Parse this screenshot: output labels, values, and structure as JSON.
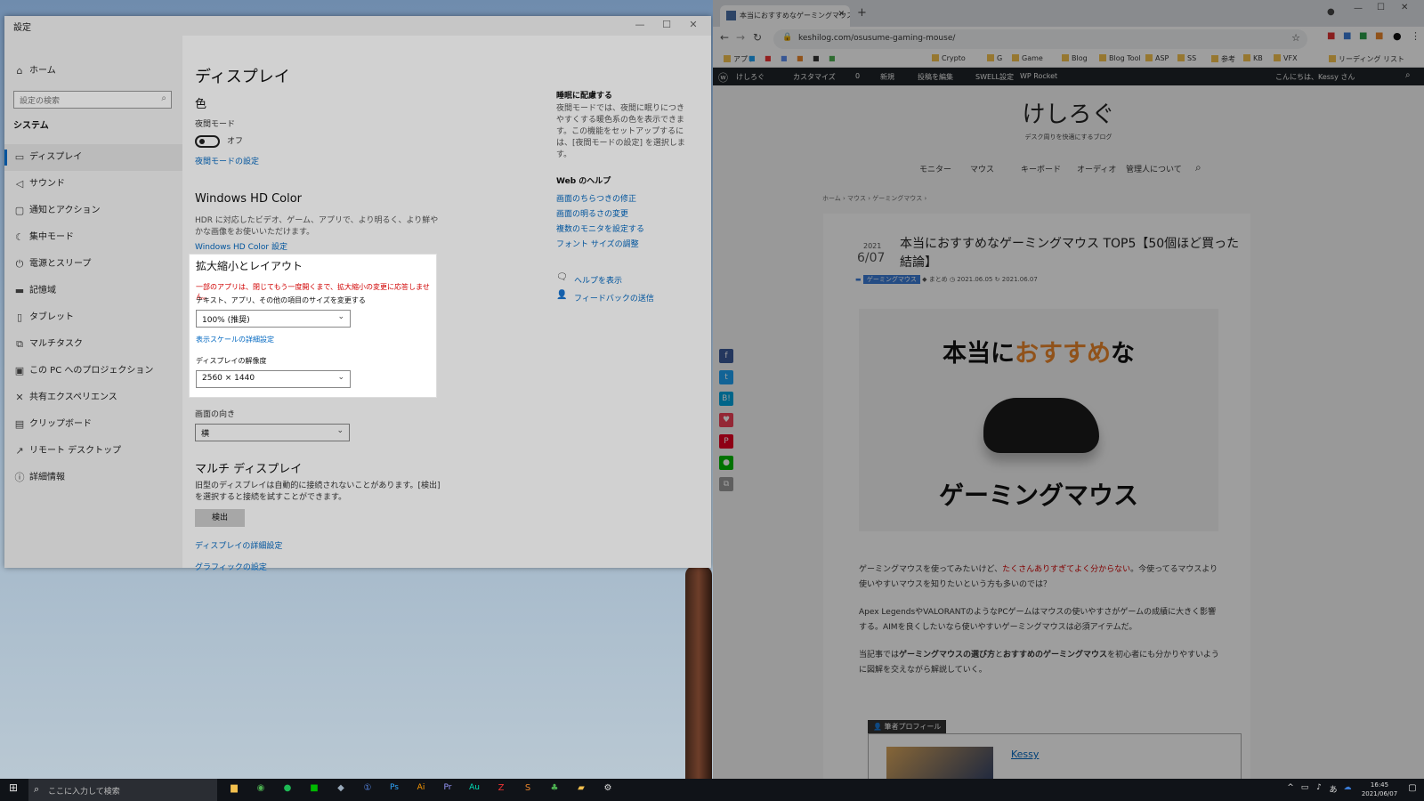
{
  "settings": {
    "window_title": "設定",
    "search_placeholder": "設定の検索",
    "home_label": "ホーム",
    "section_label": "システム",
    "sidebar_items": [
      {
        "label": "ディスプレイ",
        "icon": "monitor-icon"
      },
      {
        "label": "サウンド",
        "icon": "speaker-icon"
      },
      {
        "label": "通知とアクション",
        "icon": "notification-icon"
      },
      {
        "label": "集中モード",
        "icon": "moon-icon"
      },
      {
        "label": "電源とスリープ",
        "icon": "power-icon"
      },
      {
        "label": "記憶域",
        "icon": "storage-icon"
      },
      {
        "label": "タブレット",
        "icon": "tablet-icon"
      },
      {
        "label": "マルチタスク",
        "icon": "multitask-icon"
      },
      {
        "label": "この PC へのプロジェクション",
        "icon": "projection-icon"
      },
      {
        "label": "共有エクスペリエンス",
        "icon": "share-icon"
      },
      {
        "label": "クリップボード",
        "icon": "clipboard-icon"
      },
      {
        "label": "リモート デスクトップ",
        "icon": "remote-icon"
      },
      {
        "label": "詳細情報",
        "icon": "info-icon"
      }
    ],
    "main": {
      "title": "ディスプレイ",
      "color_heading": "色",
      "night_mode_label": "夜間モード",
      "night_mode_state": "オフ",
      "night_mode_link": "夜間モードの設定",
      "hd_heading": "Windows HD Color",
      "hd_desc": "HDR に対応したビデオ、ゲーム、アプリで、より明るく、より鮮やかな画像をお使いいただけます。",
      "hd_link": "Windows HD Color 設定",
      "scale_heading": "拡大縮小とレイアウト",
      "scale_warning": "一部のアプリは、閉じてもう一度開くまで、拡大縮小の変更に応答しません。",
      "scale_label": "テキスト、アプリ、その他の項目のサイズを変更する",
      "scale_value": "100% (推奨)",
      "scale_link": "表示スケールの詳細設定",
      "resolution_label": "ディスプレイの解像度",
      "resolution_value": "2560 × 1440",
      "orientation_label": "画面の向き",
      "orientation_value": "横",
      "multi_heading": "マルチ ディスプレイ",
      "multi_desc": "旧型のディスプレイは自動的に接続されないことがあります。[検出] を選択すると接続を試すことができます。",
      "detect_button": "検出",
      "advanced_link": "ディスプレイの詳細設定",
      "graphics_link": "グラフィックの設定"
    },
    "right": {
      "sleep_heading": "睡眠に配慮する",
      "sleep_desc": "夜間モードでは、夜間に眠りにつきやすくする暖色系の色を表示できます。この機能をセットアップするには、[夜間モードの設定] を選択します。",
      "web_help_heading": "Web のヘルプ",
      "help_links": [
        "画面のちらつきの修正",
        "画面の明るさの変更",
        "複数のモニタを設定する",
        "フォント サイズの調整"
      ],
      "show_help": "ヘルプを表示",
      "feedback": "フィードバックの送信"
    }
  },
  "browser": {
    "tab_title": "本当におすすめなゲーミングマウス TO",
    "url": "keshilog.com/osusume-gaming-mouse/",
    "bookmarks": [
      "アプリ",
      "Crypto",
      "G",
      "Game",
      "Blog",
      "Blog Tool",
      "ASP",
      "SS",
      "参考",
      "KB",
      "VFX",
      "リーディング リスト"
    ],
    "wp_items": [
      "けしろぐ",
      "カスタマイズ",
      "0",
      "新規",
      "投稿を編集",
      "SWELL設定",
      "WP Rocket"
    ],
    "wp_greeting": "こんにちは、Kessy さん",
    "site_title": "けしろぐ",
    "tagline": "デスク周りを快適にするブログ",
    "nav": [
      "モニター",
      "マウス",
      "キーボード",
      "オーディオ",
      "管理人について"
    ],
    "breadcrumb": [
      "ホーム",
      "マウス",
      "ゲーミングマウス"
    ],
    "date_year": "2021",
    "date_md": "6/07",
    "article_title": "本当におすすめなゲーミングマウス TOP5【50個ほど買った結論】",
    "category": "ゲーミングマウス",
    "tag": "まとめ",
    "published": "2021.06.05",
    "updated": "2021.06.07",
    "hero_line1_pre": "本当に",
    "hero_line1_accent": "おすすめ",
    "hero_line1_post": "な",
    "hero_line2": "ゲーミングマウス",
    "para1_pre": "ゲーミングマウスを使ってみたいけど、",
    "para1_red": "たくさんありすぎてよく分からない",
    "para1_post": "。今使ってるマウスより使いやすいマウスを知りたいという方も多いのでは？",
    "para2": "Apex LegendsやVALORANTのようなPCゲームはマウスの使いやすさがゲームの成績に大きく影響する。AIMを良くしたいなら使いやすいゲーミングマウスは必須アイテムだ。",
    "para3_pre": "当記事では",
    "para3_b1": "ゲーミングマウスの選び方",
    "para3_mid": "と",
    "para3_b2": "おすすめのゲーミングマウス",
    "para3_post": "を初心者にも分かりやすいように図解を交えながら解説していく。",
    "profile_label": "筆者プロフィール",
    "profile_name": "Kessy",
    "colors": {
      "accent": "#e8852b",
      "link": "#0067c0",
      "warning": "#d00000"
    }
  },
  "taskbar": {
    "search_placeholder": "ここに入力して検索",
    "ime": "あ",
    "time": "16:45",
    "date": "2021/06/07"
  }
}
